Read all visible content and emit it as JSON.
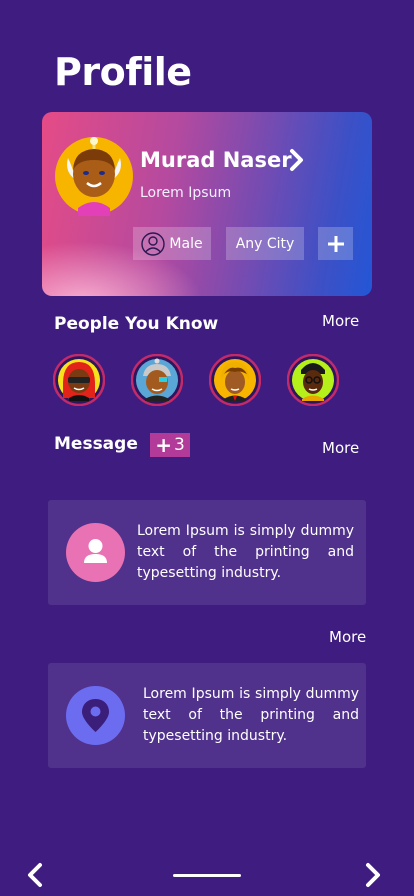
{
  "page": {
    "title": "Profile"
  },
  "profile": {
    "name": "Murad Naser",
    "subtitle": "Lorem Ipsum",
    "gender": "Male",
    "city": "Any City",
    "add_label": "+"
  },
  "people": {
    "title": "People You Know",
    "more_label": "More"
  },
  "messages": {
    "title": "Message",
    "badge_count": "3",
    "more_label": "More",
    "items": [
      {
        "icon": "person-icon",
        "text": "Lorem Ipsum is simply dummy text of the printing and typesetting industry."
      },
      {
        "icon": "location-pin-icon",
        "text": "Lorem Ipsum is simply dummy text of the printing and typesetting industry."
      }
    ],
    "more_label_2": "More"
  },
  "colors": {
    "background": "#3f1d80",
    "badge": "#b23a98",
    "person_icon_bg": "#e972b4",
    "location_icon_bg": "#6c6cf1"
  }
}
